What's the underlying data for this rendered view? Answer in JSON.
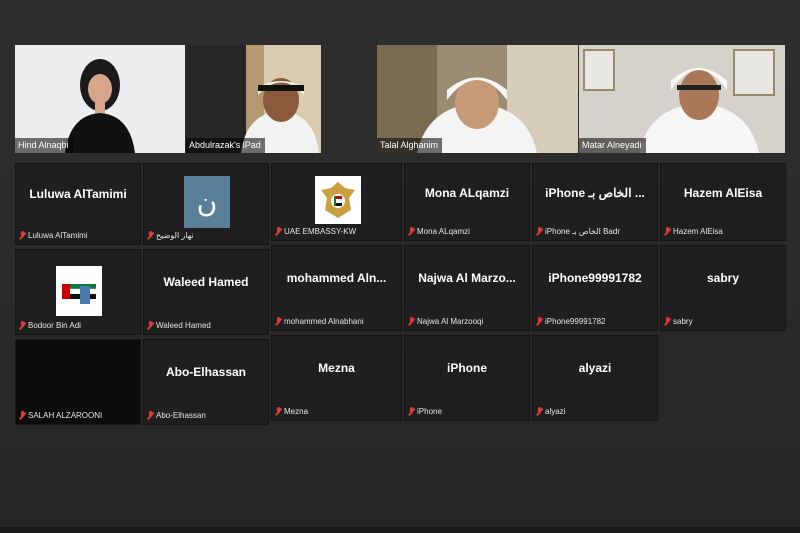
{
  "videos": [
    {
      "label": "Hind Alnaqbi"
    },
    {
      "label": "Abdulrazak's iPad"
    },
    {
      "label": "Talal Alghanim"
    },
    {
      "label": "Matar Alneyadi"
    }
  ],
  "tiles": [
    {
      "center": "Luluwa AlTamimi",
      "foot": "Luluwa AlTamimi"
    },
    {
      "center": "ن",
      "foot": "نهار الوضيح"
    },
    {
      "center": "",
      "foot": "UAE EMBASSY-KW"
    },
    {
      "center": "Mona ALqamzi",
      "foot": "Mona ALqamzi"
    },
    {
      "center": "iPhone الخاص بـ ...",
      "foot": "iPhone الخاص بـ Badr"
    },
    {
      "center": "Hazem AlEisa",
      "foot": "Hazem AlEisa"
    },
    {
      "center": "",
      "foot": "Bodoor Bin Adi"
    },
    {
      "center": "Waleed Hamed",
      "foot": "Waleed Hamed"
    },
    {
      "center": "mohammed Aln...",
      "foot": "mohammed Alnabhani"
    },
    {
      "center": "Najwa Al Marzo...",
      "foot": "Najwa Al Marzooqi"
    },
    {
      "center": "iPhone99991782",
      "foot": "iPhone99991782"
    },
    {
      "center": "sabry",
      "foot": "sabry"
    },
    {
      "center": "",
      "foot": "SALAH ALZAROONI"
    },
    {
      "center": "Abo-Elhassan",
      "foot": "Abo-Elhassan"
    },
    {
      "center": "Mezna",
      "foot": "Mezna"
    },
    {
      "center": "iPhone",
      "foot": "iPhone"
    },
    {
      "center": "alyazi",
      "foot": "alyazi"
    }
  ],
  "colors": {
    "muted_mic": "#e03a3a",
    "tile_bg": "#1f1f1f",
    "avatar_teal": "#5a7f99"
  },
  "icons": {
    "mic": "microphone-muted-icon"
  }
}
